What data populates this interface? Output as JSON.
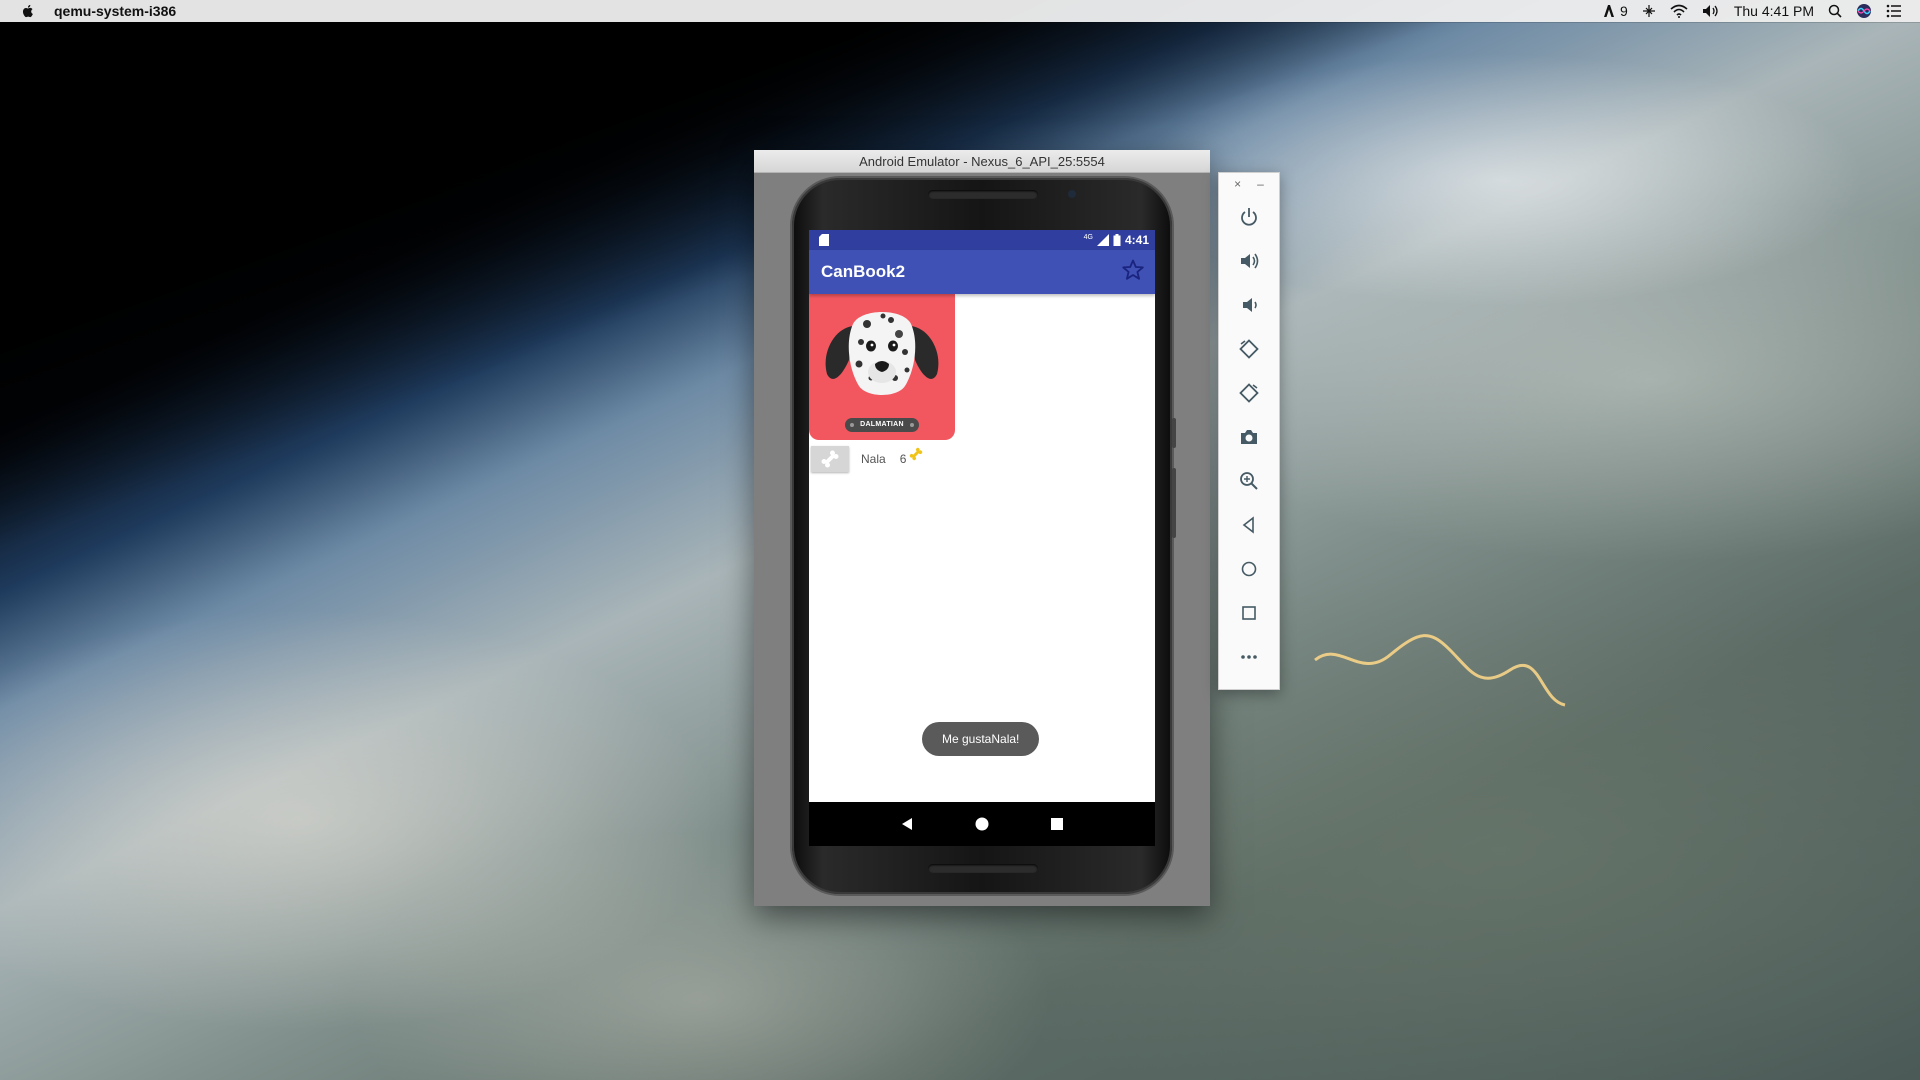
{
  "menubar": {
    "app_name": "qemu-system-i386",
    "adobe_count": "9",
    "clock": "Thu 4:41 PM"
  },
  "emulator": {
    "window_title": "Android Emulator - Nexus_6_API_25:5554",
    "screen": {
      "status_time": "4:41",
      "network_label": "4G",
      "app_title": "CanBook2",
      "pet": {
        "breed_label": "DALMATIAN",
        "name": "Nala",
        "likes": "6"
      },
      "toast": "Me gustaNala!"
    },
    "side_toolbar": {
      "close": "×",
      "minimize": "–",
      "tools": [
        "power-icon",
        "volume-up-icon",
        "volume-down-icon",
        "rotate-left-icon",
        "rotate-right-icon",
        "camera-icon",
        "zoom-icon",
        "back-icon",
        "home-icon",
        "overview-icon",
        "more-icon"
      ]
    }
  },
  "colors": {
    "status_bar": "#303f9f",
    "toolbar": "#3f51b5",
    "pet_card": "#f2575f",
    "toast": "#5a5a5a"
  }
}
